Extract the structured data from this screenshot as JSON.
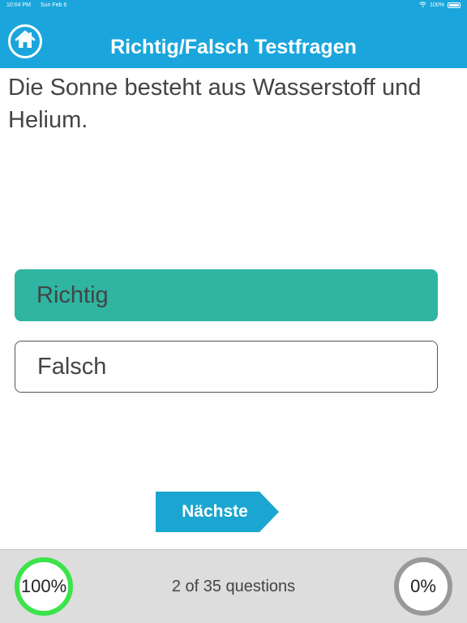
{
  "status_bar": {
    "time": "10:04 PM",
    "date": "Sun Feb 6",
    "battery": "100%"
  },
  "header": {
    "title": "Richtig/Falsch Testfragen",
    "home_icon": "home-icon"
  },
  "question": {
    "text": "Die Sonne besteht aus Wasserstoff und Helium."
  },
  "options": [
    {
      "label": "Richtig",
      "selected": true
    },
    {
      "label": "Falsch",
      "selected": false
    }
  ],
  "next_button": {
    "label": "Nächste"
  },
  "footer": {
    "correct_percent": "100%",
    "progress_text": "2 of 35 questions",
    "wrong_percent": "0%"
  },
  "colors": {
    "header": "#1aa6dc",
    "selected_option": "#2fb5a2",
    "next_button": "#1aa6d0",
    "correct_ring": "#3de34a",
    "wrong_ring": "#999999"
  }
}
